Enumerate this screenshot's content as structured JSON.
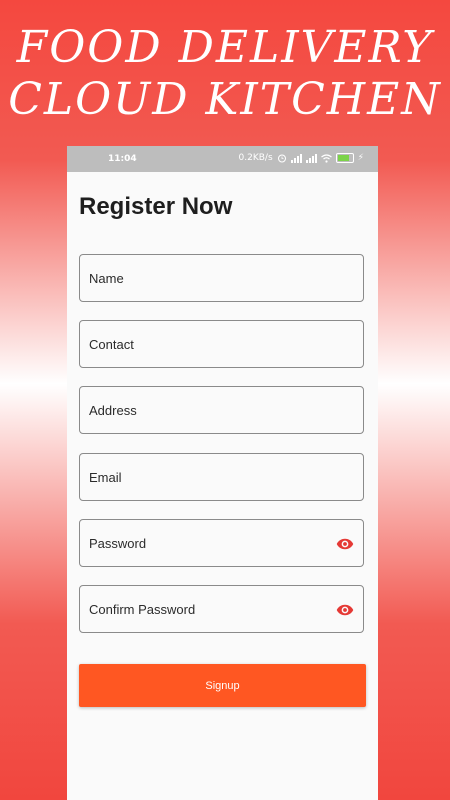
{
  "banner": {
    "line1": "FOOD DELIVERY",
    "line2": "CLOUD KITCHEN"
  },
  "status_bar": {
    "time": "11:04",
    "network_speed": "0.2KB/s",
    "icons": [
      "alarm-icon",
      "signal-icon",
      "signal-icon",
      "wifi-icon",
      "battery-icon",
      "charging-icon"
    ],
    "battery": "48"
  },
  "page": {
    "title": "Register Now"
  },
  "form": {
    "fields": [
      {
        "label": "Name"
      },
      {
        "label": "Contact"
      },
      {
        "label": "Address"
      },
      {
        "label": "Email"
      },
      {
        "label": "Password",
        "icon": "eye-icon"
      },
      {
        "label": "Confirm Password",
        "icon": "eye-icon"
      }
    ],
    "signup_label": "Signup"
  },
  "colors": {
    "accent": "#ff5722",
    "eye_icon": "#e53935",
    "banner_red": "#f4483f"
  }
}
